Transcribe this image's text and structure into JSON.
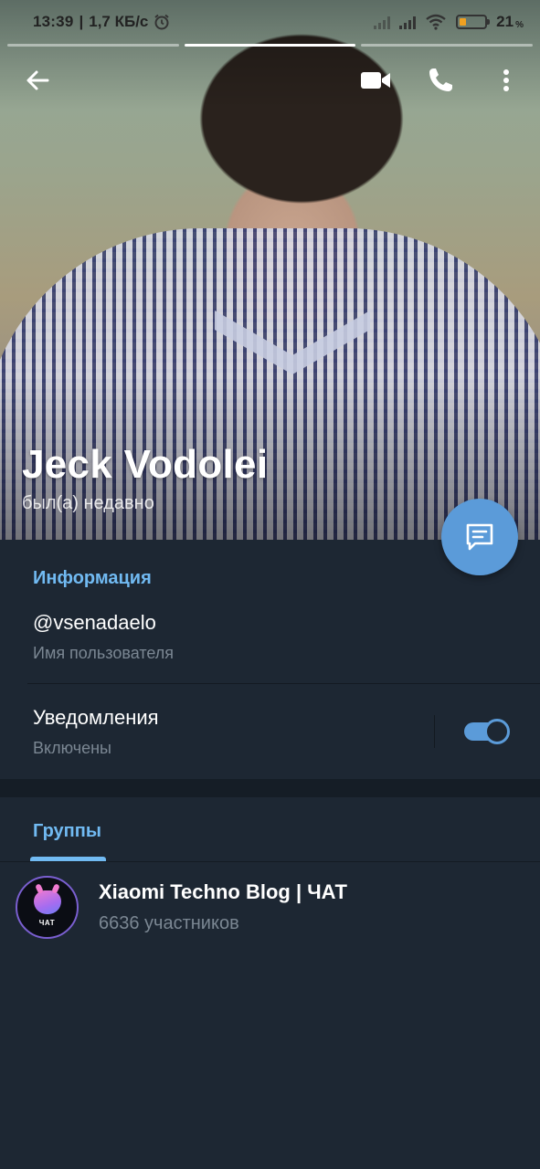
{
  "status_bar": {
    "time": "13:39",
    "speed": "1,7 КБ/с",
    "battery": "21"
  },
  "profile": {
    "name": "Jeck Vodolei",
    "status": "был(а) недавно"
  },
  "topbar": {
    "icons": [
      "back-arrow-icon",
      "video-camera-icon",
      "phone-icon",
      "more-vertical-icon"
    ]
  },
  "info": {
    "section_title": "Информация",
    "username": "@vsenadaelo",
    "username_label": "Имя пользователя",
    "notifications_title": "Уведомления",
    "notifications_value": "Включены"
  },
  "groups": {
    "tab_label": "Группы",
    "items": [
      {
        "name": "Xiaomi Techno Blog | ЧАТ",
        "members": "6636 участников",
        "avatar_text": "ЧАТ"
      }
    ]
  },
  "colors": {
    "background": "#1d2733",
    "accent": "#5b9bd9",
    "section_title": "#71baf2",
    "muted_text": "#7b8793"
  }
}
